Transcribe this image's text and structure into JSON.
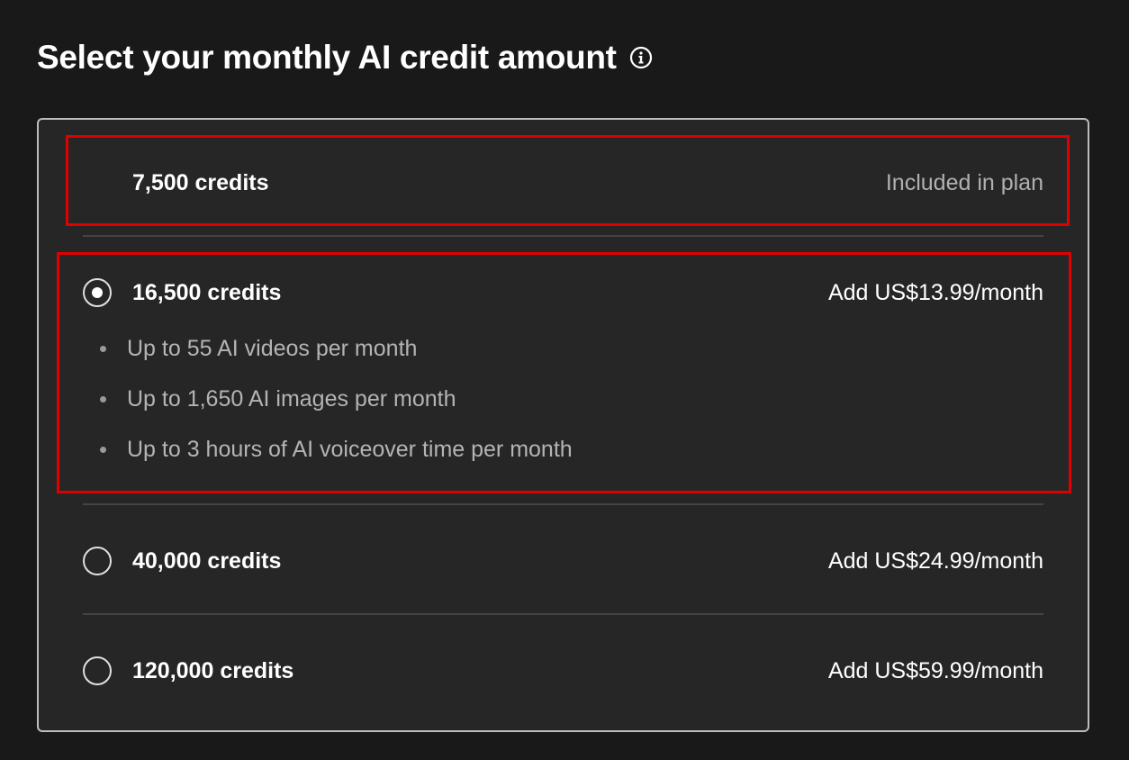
{
  "header": {
    "title": "Select your monthly AI credit amount",
    "info_icon": "info-circle-icon"
  },
  "options": [
    {
      "credits": "7,500 credits",
      "price": "Included in plan",
      "selectable": false,
      "selected": false
    },
    {
      "credits": "16,500 credits",
      "price": "Add US$13.99/month",
      "selectable": true,
      "selected": true,
      "features": [
        "Up to 55 AI videos per month",
        "Up to 1,650 AI images per month",
        "Up to 3 hours of AI voiceover time per month"
      ]
    },
    {
      "credits": "40,000 credits",
      "price": "Add US$24.99/month",
      "selectable": true,
      "selected": false
    },
    {
      "credits": "120,000 credits",
      "price": "Add US$59.99/month",
      "selectable": true,
      "selected": false
    }
  ],
  "colors": {
    "background": "#191919",
    "panel": "#262626",
    "highlight": "#e00000",
    "muted_text": "#b0b0b0"
  }
}
